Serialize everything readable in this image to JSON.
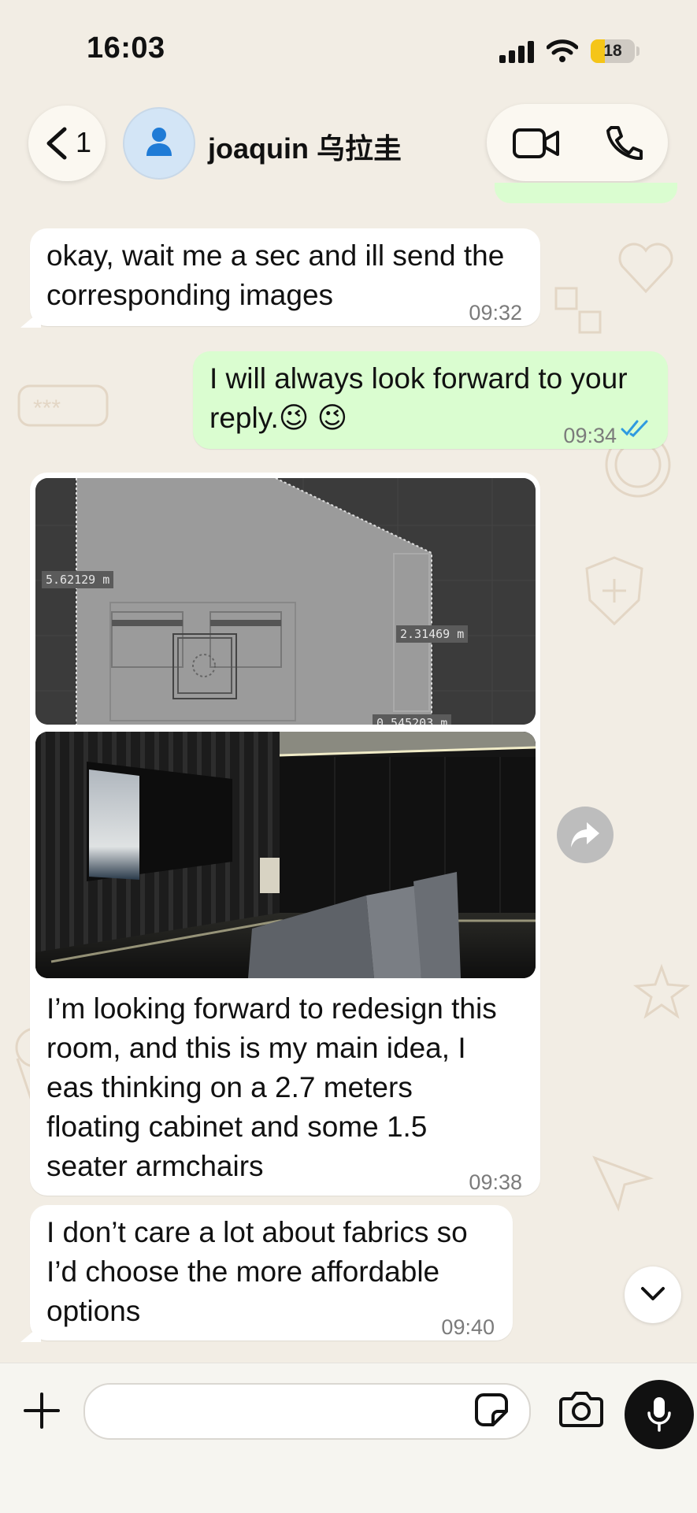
{
  "status_bar": {
    "time": "16:03",
    "battery": "18",
    "battery_level": 0.18
  },
  "header": {
    "back_count": "1",
    "contact_name": "joaquin 乌拉圭",
    "icons": [
      "chevron-left-icon",
      "person-icon",
      "video-call-icon",
      "phone-call-icon"
    ]
  },
  "messages": [
    {
      "direction": "incoming",
      "text": "okay, wait me a sec and ill send the\ncorresponding images",
      "time": "09:32"
    },
    {
      "direction": "outgoing",
      "text": "I will always look forward to your\nreply.😉 😉",
      "time": "09:34",
      "status": "read"
    },
    {
      "direction": "incoming",
      "images": [
        {
          "kind": "floor-plan screenshot",
          "labels": [
            "5.62129 m",
            "2.31469 m",
            "0.545203 m"
          ]
        },
        {
          "kind": "3D room render"
        }
      ],
      "text": "I’m looking forward to redesign this\nroom, and this is my main idea, I\neas thinking on a 2.7 meters\nfloating cabinet and some 1.5\nseater armchairs",
      "time": "09:38"
    },
    {
      "direction": "incoming",
      "text": "I don’t care a lot about fabrics so\nI’d choose the more affordable\noptions",
      "time": "09:40"
    }
  ],
  "input": {
    "placeholder": "",
    "value": ""
  },
  "colors": {
    "incoming_bubble": "#ffffff",
    "outgoing_bubble": "#dafdd0",
    "read_ticks": "#2f9ae0",
    "background": "#f2ede4"
  }
}
